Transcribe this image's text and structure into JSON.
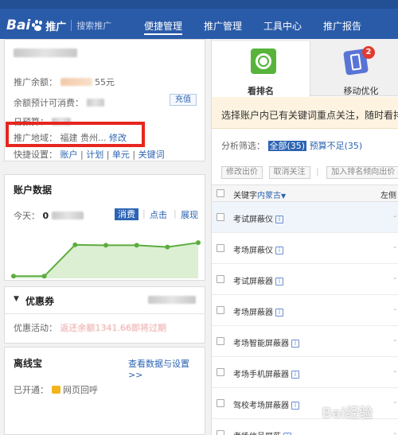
{
  "header": {
    "logo_text": "Bai",
    "logo_tui": "推广",
    "logo_sub": "搜索推广",
    "nav": [
      {
        "label": "便捷管理",
        "active": true
      },
      {
        "label": "推广管理",
        "active": false
      },
      {
        "label": "工具中心",
        "active": false
      },
      {
        "label": "推广报告",
        "active": false
      }
    ]
  },
  "account": {
    "balance_label": "推广余额：",
    "balance_tail": "55元",
    "est_label": "余额预计可消费：",
    "recharge": "充值",
    "daily_budget_label": "日预算：",
    "region_label": "推广地域：",
    "region_value": "福建 贵州...",
    "region_edit": "修改",
    "quick_label": "快捷设置：",
    "quick_links": [
      "账户",
      "计划",
      "单元",
      "关键词"
    ]
  },
  "data_panel": {
    "title": "账户数据",
    "today_label": "今天：",
    "today_value": "0",
    "metrics": [
      "消费",
      "点击",
      "展现"
    ],
    "active_metric": "消费"
  },
  "chart_data": {
    "type": "area",
    "x": [
      1,
      2,
      3,
      4,
      5,
      6,
      7
    ],
    "series": [
      {
        "values": [
          0.05,
          0.05,
          0.78,
          0.77,
          0.77,
          0.73,
          0.83
        ]
      }
    ],
    "title": "",
    "xlabel": "",
    "ylabel": "",
    "ylim": [
      0,
      1
    ],
    "grid": false,
    "color": "#5bad3f"
  },
  "coupon": {
    "title": "优惠券",
    "activity_label": "优惠活动：",
    "activity_text": "返还余额1341.66即将过期"
  },
  "lixian": {
    "title": "离线宝",
    "settings_link": "查看数据与设置 >>",
    "enabled_label": "已开通：",
    "enabled_item": "网页回呼"
  },
  "right": {
    "tabs": [
      {
        "label": "看排名",
        "active": true
      },
      {
        "label": "移动优化",
        "active": false,
        "badge": "2"
      }
    ],
    "notice": "选择账户内已有关键词重点关注，随时看排名，",
    "filter_label": "分析筛选：",
    "filter_all": "全部(35)",
    "filter_budget": "预算不足(35)",
    "actions": [
      "修改出价",
      "取消关注",
      "加入排名倾向出价"
    ],
    "col_keyword": "关键字",
    "col_region": "内蒙古",
    "col_right": "左侧",
    "keywords": [
      "考试屏蔽仪",
      "考场屏蔽仪",
      "考试屏蔽器",
      "考场屏蔽器",
      "考场智能屏蔽器",
      "考场手机屏蔽器",
      "驾校考场屏蔽器",
      "考场信号屏蔽"
    ],
    "dash": "-"
  },
  "watermark": "Bai经验"
}
